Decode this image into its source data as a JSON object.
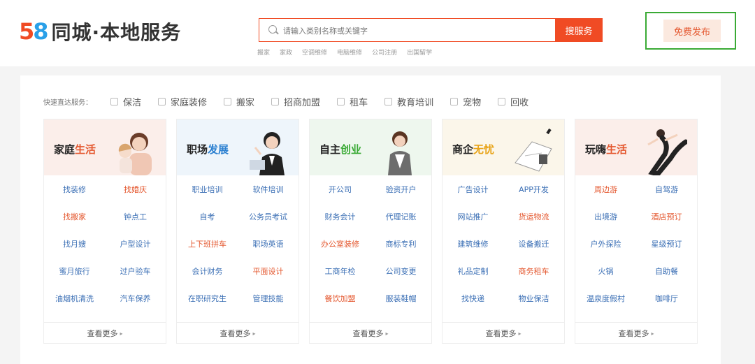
{
  "logo": {
    "digit1": "5",
    "digit2": "8",
    "name": "同城·本地服务"
  },
  "search": {
    "placeholder": "请输入类别名称或关键字",
    "button": "搜服务"
  },
  "hotwords": [
    "搬家",
    "家政",
    "空调维修",
    "电脑维修",
    "公司注册",
    "出国留学"
  ],
  "publish_button": "免费发布",
  "quicknav": {
    "label": "快速直达服务：",
    "items": [
      "保洁",
      "家庭装修",
      "搬家",
      "招商加盟",
      "租车",
      "教育培训",
      "宠物",
      "回收"
    ]
  },
  "categories": [
    {
      "title_main": "家庭",
      "title_accent": "生活",
      "accent_color": "#e4572e",
      "head_bg": "#fbeeea",
      "links": [
        "找装修",
        "找婚庆",
        "找搬家",
        "钟点工",
        "找月嫂",
        "户型设计",
        "蜜月旅行",
        "过户验车",
        "油烟机清洗",
        "汽车保养"
      ],
      "hot": [
        1,
        2
      ],
      "more": "查看更多"
    },
    {
      "title_main": "职场",
      "title_accent": "发展",
      "accent_color": "#2a7fd0",
      "head_bg": "#eef5fb",
      "links": [
        "职业培训",
        "软件培训",
        "自考",
        "公务员考试",
        "上下班拼车",
        "职场英语",
        "会计财务",
        "平面设计",
        "在职研究生",
        "管理技能"
      ],
      "hot": [
        4,
        7
      ],
      "more": "查看更多"
    },
    {
      "title_main": "自主",
      "title_accent": "创业",
      "accent_color": "#3aaa35",
      "head_bg": "#eef7ee",
      "links": [
        "开公司",
        "验资开户",
        "财务会计",
        "代理记账",
        "办公室装修",
        "商标专利",
        "工商年检",
        "公司变更",
        "餐饮加盟",
        "服装鞋帽"
      ],
      "hot": [
        4,
        8
      ],
      "more": "查看更多"
    },
    {
      "title_main": "商企",
      "title_accent": "无忧",
      "accent_color": "#e8a317",
      "head_bg": "#fbf6ea",
      "links": [
        "广告设计",
        "APP开发",
        "网站推广",
        "货运物流",
        "建筑维修",
        "设备搬迁",
        "礼品定制",
        "商务租车",
        "找快递",
        "物业保洁"
      ],
      "hot": [
        3,
        7
      ],
      "more": "查看更多"
    },
    {
      "title_main": "玩嗨",
      "title_accent": "生活",
      "accent_color": "#e4572e",
      "head_bg": "#fbeeea",
      "links": [
        "周边游",
        "自驾游",
        "出境游",
        "酒店预订",
        "户外探险",
        "星级预订",
        "火锅",
        "自助餐",
        "温泉度假村",
        "咖啡厅"
      ],
      "hot": [
        0,
        3
      ],
      "more": "查看更多"
    }
  ]
}
